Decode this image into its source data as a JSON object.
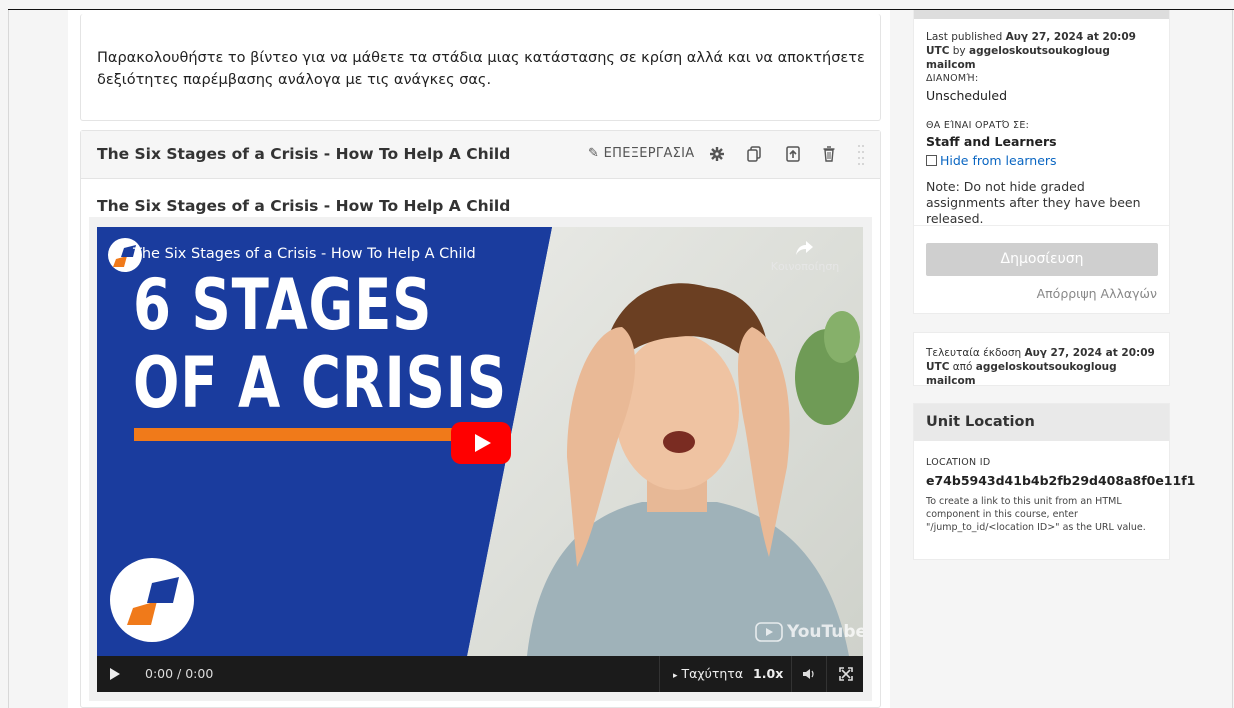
{
  "intro": {
    "text": "Παρακολουθήστε το βίντεο για να μάθετε τα στάδια μιας κατάστασης σε κρίση αλλά και να αποκτήσετε δεξιότητες παρέμβασης ανάλογα με τις ανάγκες σας."
  },
  "component": {
    "title": "The Six Stages of a Crisis - How To Help A Child",
    "edit_label": "ΕΠΕΞΕΡΓΑΣΙΑ",
    "video_heading": "The Six Stages of a Crisis - How To Help A Child"
  },
  "video": {
    "overlay_title": "The Six Stages of a Crisis - How To Help A Child",
    "share_label": "Κοινοποίηση",
    "thumb_line1": "6 STAGES",
    "thumb_line2": "OF A CRISIS",
    "watermark": "YouTube",
    "time": "0:00 / 0:00",
    "speed_label": "Ταχύτητα",
    "speed_value": "1.0x"
  },
  "publish": {
    "last_published_prefix": "Last published",
    "last_published_date": "Αυγ 27, 2024 at 20:09 UTC",
    "by_word": "by",
    "last_published_user": "aggeloskoutsoukogloug mailcom",
    "release_label": "ΔΙΑΝΟΜΉ:",
    "release_value": "Unscheduled",
    "visible_label": "ΘΑ ΕΊΝΑΙ ΟΡΑΤΌ ΣΕ:",
    "visible_value": "Staff and Learners",
    "hide_label": "Hide from learners",
    "note": "Note: Do not hide graded assignments after they have been released.",
    "publish_button": "Δημοσίευση",
    "discard_link": "Απόρριψη Αλλαγών"
  },
  "last_version": {
    "prefix": "Τελευταία έκδοση",
    "date": "Αυγ 27, 2024 at 20:09 UTC",
    "from_word": "από",
    "user": "aggeloskoutsoukogloug mailcom"
  },
  "unit_location": {
    "title": "Unit Location",
    "id_label": "LOCATION ID",
    "id_value": "e74b5943d41b4b2fb29d408a8f0e11f1",
    "help": "To create a link to this unit from an HTML component in this course, enter \"/jump_to_id/<location ID>\" as the URL value."
  },
  "colors": {
    "link": "#0a66c2",
    "youtube_red": "#ff0000",
    "thumb_blue": "#1a3c9e",
    "thumb_orange": "#f07a1a"
  }
}
